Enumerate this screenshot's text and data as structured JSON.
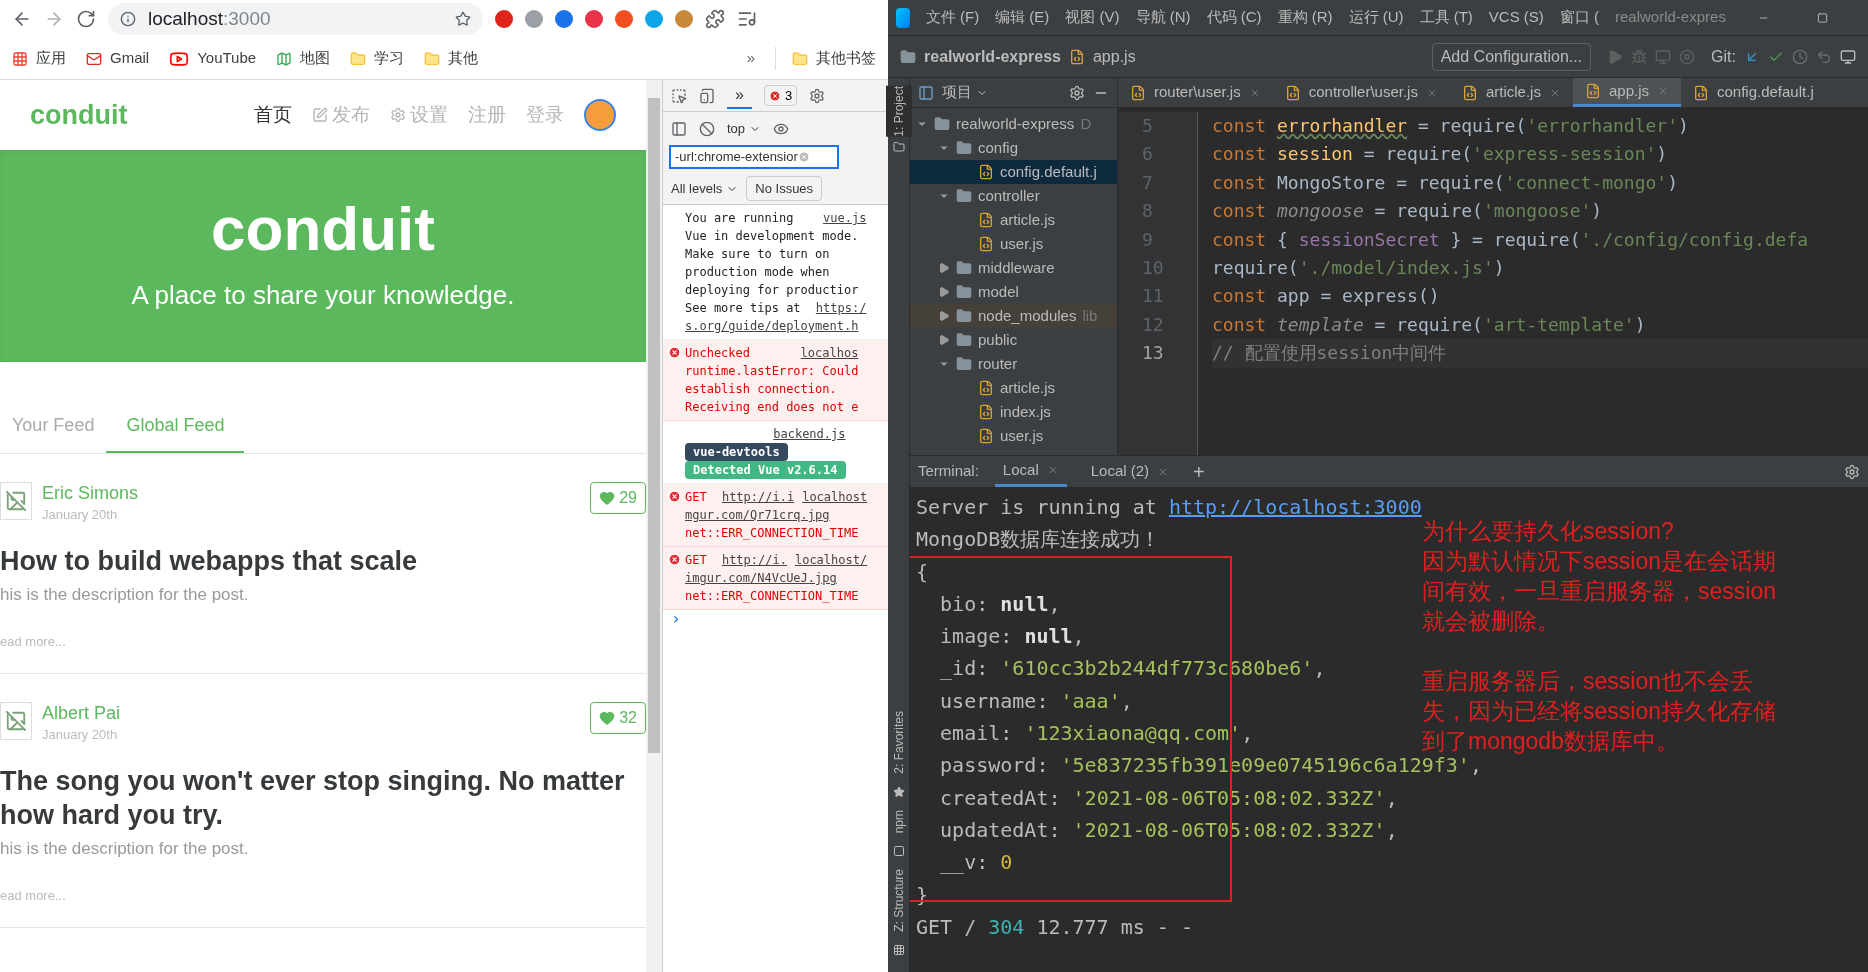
{
  "browser": {
    "address_host": "localhost",
    "address_port": ":3000",
    "bookmarks": [
      {
        "label": "应用",
        "kind": "apps"
      },
      {
        "label": "Gmail",
        "kind": "gmail"
      },
      {
        "label": "YouTube",
        "kind": "youtube"
      },
      {
        "label": "地图",
        "kind": "maps"
      },
      {
        "label": "学习",
        "kind": "folder"
      },
      {
        "label": "其他",
        "kind": "folder"
      }
    ],
    "overflow": "»",
    "other_bookmarks": "其他书签"
  },
  "page": {
    "brand": "conduit",
    "nav": [
      {
        "label": "首页",
        "selected": true,
        "kind": "plain"
      },
      {
        "label": "发布",
        "selected": false,
        "kind": "edit"
      },
      {
        "label": "设置",
        "selected": false,
        "kind": "gear"
      },
      {
        "label": "注册",
        "selected": false,
        "kind": "plain"
      },
      {
        "label": "登录",
        "selected": false,
        "kind": "plain"
      }
    ],
    "banner": {
      "title": "conduit",
      "subtitle": "A place to share your knowledge."
    },
    "feed_tabs": [
      {
        "label": "Your Feed",
        "selected": false
      },
      {
        "label": "Global Feed",
        "selected": true
      }
    ],
    "articles": [
      {
        "author": "Eric Simons",
        "date": "January 20th",
        "likes": "29",
        "title": "How to build webapps that scale",
        "description": "his is the description for the post.",
        "read_more": "ead more..."
      },
      {
        "author": "Albert Pai",
        "date": "January 20th",
        "likes": "32",
        "title": "The song you won't ever stop singing. No matter how hard you try.",
        "description": "his is the description for the post.",
        "read_more": "ead more..."
      }
    ]
  },
  "devtools": {
    "overflow": "»",
    "error_count": "3",
    "context": "top",
    "filter": "-url:chrome-extensior",
    "levels": "All levels",
    "issues": "No Issues",
    "messages": [
      {
        "kind": "log",
        "source": "vue.js",
        "lines": [
          {
            "text": "You are running"
          },
          {
            "text": "Vue in development mode."
          },
          {
            "text": "Make sure to turn on"
          },
          {
            "text": "production mode when"
          },
          {
            "text": "deploying for productior"
          },
          {
            "text": "See more tips at ",
            "link": "https:/"
          },
          {
            "link": "s.org/guide/deployment.h"
          }
        ]
      },
      {
        "kind": "error",
        "source": "localhos",
        "lines": [
          {
            "text": "Unchecked"
          },
          {
            "text": "runtime.lastError: Could"
          },
          {
            "text": "establish connection."
          },
          {
            "text": "Receiving end does not e"
          }
        ]
      },
      {
        "kind": "badges",
        "source": "backend.js",
        "badges": [
          {
            "text": "vue-devtools",
            "color": "#35495e"
          },
          {
            "text": "Detected Vue v2.6.14",
            "color": "#41b883"
          }
        ]
      },
      {
        "kind": "error",
        "source": "localhost",
        "lines": [
          {
            "text": "GET ",
            "link": "http://i.i"
          },
          {
            "link": "mgur.com/Qr71crq.jpg"
          },
          {
            "text": "net::ERR_CONNECTION_TIME"
          }
        ]
      },
      {
        "kind": "error",
        "source": "localhost/",
        "lines": [
          {
            "text": "GET ",
            "link": "http://i."
          },
          {
            "link": "imgur.com/N4VcUeJ.jpg"
          },
          {
            "text": "net::ERR_CONNECTION_TIME"
          }
        ]
      }
    ],
    "prompt": "›"
  },
  "ide": {
    "menu": [
      "文件 (F)",
      "编辑 (E)",
      "视图 (V)",
      "导航 (N)",
      "代码 (C)",
      "重构 (R)",
      "运行 (U)",
      "工具 (T)",
      "VCS (S)",
      "窗口 ("
    ],
    "title": "realworld-expres",
    "breadcrumb": [
      "realworld-express",
      "app.js"
    ],
    "run_config": "Add Configuration...",
    "git": "Git:",
    "side_tools": [
      {
        "label": "1: Project",
        "selected": true
      },
      {
        "label": "2: Favorites",
        "selected": false
      },
      {
        "label": "npm",
        "selected": false
      },
      {
        "label": "Z: Structure",
        "selected": false
      }
    ],
    "project_header": "项目",
    "editor_tabs": [
      {
        "label": "router\\user.js",
        "selected": false
      },
      {
        "label": "controller\\user.js",
        "selected": false
      },
      {
        "label": "article.js",
        "selected": false
      },
      {
        "label": "app.js",
        "selected": true
      },
      {
        "label": "config.default.j",
        "selected": false
      }
    ],
    "tree": [
      {
        "label": "realworld-express",
        "note": "D",
        "kind": "folder",
        "expanded": true,
        "selected": false,
        "children": [
          {
            "label": "config",
            "kind": "folder",
            "expanded": true,
            "selected": false,
            "children": [
              {
                "label": "config.default.j",
                "kind": "file",
                "selected": true
              }
            ]
          },
          {
            "label": "controller",
            "kind": "folder",
            "expanded": true,
            "selected": false,
            "children": [
              {
                "label": "article.js",
                "kind": "file",
                "selected": false
              },
              {
                "label": "user.js",
                "kind": "file",
                "selected": false
              }
            ]
          },
          {
            "label": "middleware",
            "kind": "folder",
            "expanded": false,
            "selected": false
          },
          {
            "label": "model",
            "kind": "folder",
            "expanded": false,
            "selected": false
          },
          {
            "label": "node_modules",
            "note": "lib",
            "kind": "excluded",
            "expanded": false,
            "selected": false
          },
          {
            "label": "public",
            "kind": "folder",
            "expanded": false,
            "selected": false
          },
          {
            "label": "router",
            "kind": "folder",
            "expanded": true,
            "selected": false,
            "children": [
              {
                "label": "article.js",
                "kind": "file",
                "selected": false
              },
              {
                "label": "index.js",
                "kind": "file",
                "selected": false
              },
              {
                "label": "user.js",
                "kind": "file",
                "selected": false
              }
            ]
          }
        ]
      }
    ],
    "code": [
      {
        "number": "5",
        "current": false,
        "tokens": [
          {
            "t": "const ",
            "kind": "kw"
          },
          {
            "t": "errorhandler",
            "kind": "warn"
          },
          {
            "t": " = require(",
            "kind": "id"
          },
          {
            "t": "'errorhandler'",
            "kind": "str"
          },
          {
            "t": ")",
            "kind": "id"
          }
        ]
      },
      {
        "number": "6",
        "current": false,
        "tokens": [
          {
            "t": "const ",
            "kind": "kw"
          },
          {
            "t": "session",
            "kind": "decl"
          },
          {
            "t": " = require(",
            "kind": "id"
          },
          {
            "t": "'express-session'",
            "kind": "str"
          },
          {
            "t": ")",
            "kind": "id"
          }
        ]
      },
      {
        "number": "7",
        "current": false,
        "tokens": [
          {
            "t": "const ",
            "kind": "kw"
          },
          {
            "t": "MongoStore = require(",
            "kind": "id"
          },
          {
            "t": "'connect-mongo'",
            "kind": "str"
          },
          {
            "t": ")",
            "kind": "id"
          }
        ]
      },
      {
        "number": "8",
        "current": false,
        "tokens": [
          {
            "t": "const ",
            "kind": "kw"
          },
          {
            "t": "mongoose",
            "kind": "unused"
          },
          {
            "t": " = require(",
            "kind": "id"
          },
          {
            "t": "'mongoose'",
            "kind": "str"
          },
          {
            "t": ")",
            "kind": "id"
          }
        ]
      },
      {
        "number": "9",
        "current": false,
        "tokens": [
          {
            "t": "const ",
            "kind": "kw"
          },
          {
            "t": "{ ",
            "kind": "id"
          },
          {
            "t": "sessionSecret",
            "kind": "field"
          },
          {
            "t": " } = require(",
            "kind": "id"
          },
          {
            "t": "'./config/config.defa",
            "kind": "str"
          }
        ]
      },
      {
        "number": "10",
        "current": false,
        "tokens": [
          {
            "t": "require(",
            "kind": "id"
          },
          {
            "t": "'./model/index.js'",
            "kind": "str"
          },
          {
            "t": ")",
            "kind": "id"
          }
        ]
      },
      {
        "number": "11",
        "current": false,
        "tokens": [
          {
            "t": "const ",
            "kind": "kw"
          },
          {
            "t": "app = express()",
            "kind": "id"
          }
        ]
      },
      {
        "number": "12",
        "current": false,
        "tokens": [
          {
            "t": "const ",
            "kind": "kw"
          },
          {
            "t": "template",
            "kind": "unused"
          },
          {
            "t": " = require(",
            "kind": "id"
          },
          {
            "t": "'art-template'",
            "kind": "str"
          },
          {
            "t": ")",
            "kind": "id"
          }
        ]
      },
      {
        "number": "13",
        "current": true,
        "tokens": [
          {
            "t": "// 配置使用session中间件",
            "kind": "comment"
          }
        ]
      }
    ],
    "terminal": {
      "label": "Terminal:",
      "tabs": [
        {
          "label": "Local",
          "selected": true
        },
        {
          "label": "Local (2)",
          "selected": false
        }
      ],
      "add": "+",
      "lines": [
        [
          {
            "t": "Server is running at ",
            "kind": "plain"
          },
          {
            "t": "http://localhost:3000",
            "kind": "link"
          }
        ],
        [
          {
            "t": "MongoDB数据库连接成功！",
            "kind": "plain"
          }
        ],
        [
          {
            "t": "{",
            "kind": "plain"
          }
        ],
        [
          {
            "t": "  bio: ",
            "kind": "plain"
          },
          {
            "t": "null",
            "kind": "bold"
          },
          {
            "t": ",",
            "kind": "plain"
          }
        ],
        [
          {
            "t": "  image: ",
            "kind": "plain"
          },
          {
            "t": "null",
            "kind": "bold"
          },
          {
            "t": ",",
            "kind": "plain"
          }
        ],
        [
          {
            "t": "  _id: ",
            "kind": "plain"
          },
          {
            "t": "'610cc3b2b244df773c680be6'",
            "kind": "str"
          },
          {
            "t": ",",
            "kind": "plain"
          }
        ],
        [
          {
            "t": "  username: ",
            "kind": "plain"
          },
          {
            "t": "'aaa'",
            "kind": "str"
          },
          {
            "t": ",",
            "kind": "plain"
          }
        ],
        [
          {
            "t": "  email: ",
            "kind": "plain"
          },
          {
            "t": "'123xiaona@qq.com'",
            "kind": "str"
          },
          {
            "t": ",",
            "kind": "plain"
          }
        ],
        [
          {
            "t": "  password: ",
            "kind": "plain"
          },
          {
            "t": "'5e837235fb391e09e0745196c6a129f3'",
            "kind": "str"
          },
          {
            "t": ",",
            "kind": "plain"
          }
        ],
        [
          {
            "t": "  createdAt: ",
            "kind": "plain"
          },
          {
            "t": "'2021-08-06T05:08:02.332Z'",
            "kind": "str"
          },
          {
            "t": ",",
            "kind": "plain"
          }
        ],
        [
          {
            "t": "  updatedAt: ",
            "kind": "plain"
          },
          {
            "t": "'2021-08-06T05:08:02.332Z'",
            "kind": "str"
          },
          {
            "t": ",",
            "kind": "plain"
          }
        ],
        [
          {
            "t": "  __v: ",
            "kind": "plain"
          },
          {
            "t": "0",
            "kind": "num"
          }
        ],
        [
          {
            "t": "}",
            "kind": "plain"
          }
        ],
        [
          {
            "t": "GET / ",
            "kind": "plain"
          },
          {
            "t": "304",
            "kind": "status"
          },
          {
            "t": " 12.777 ms - -",
            "kind": "plain"
          }
        ]
      ],
      "annotation": [
        "为什么要持久化session?",
        "因为默认情况下session是在会话期间有效，一旦重启服务器，session就会被删除。",
        "重启服务器后，session也不会丢失，因为已经将session持久化存储到了mongodb数据库中。"
      ]
    }
  }
}
